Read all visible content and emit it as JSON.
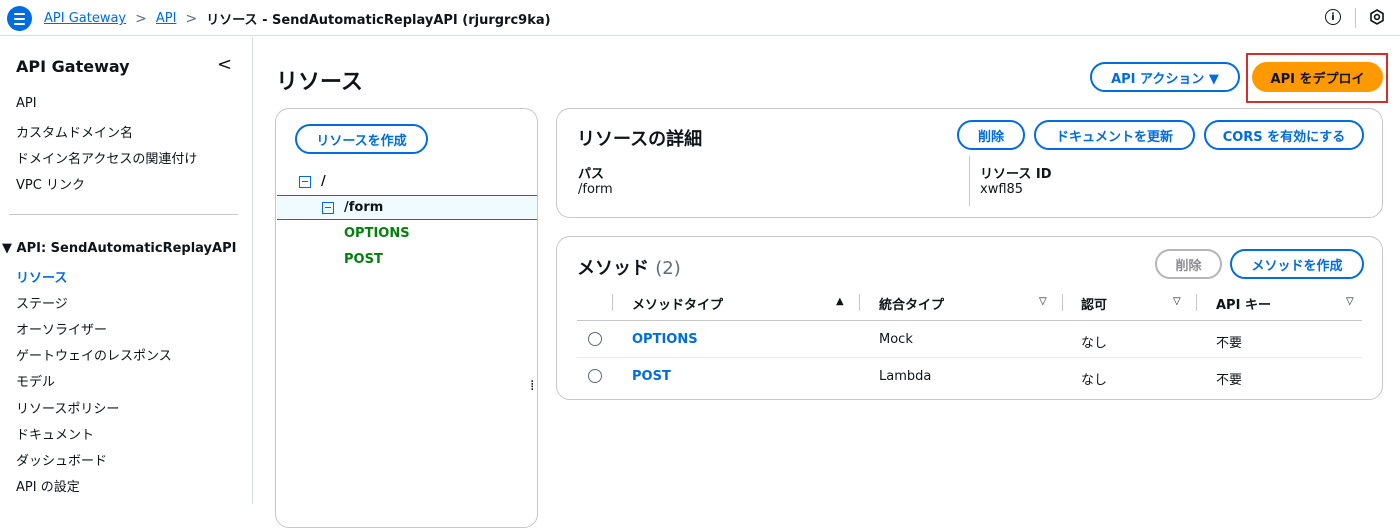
{
  "header": {
    "breadcrumbs": [
      "API Gateway",
      "API",
      "リソース - SendAutomaticReplayAPI (rjurgrc9ka)"
    ],
    "separator": ">",
    "info_label": "i"
  },
  "sidebar": {
    "title": "API Gateway",
    "collapse_label": "<",
    "top_items": [
      "API",
      "カスタムドメイン名",
      "ドメイン名アクセスの関連付け",
      "VPC リンク"
    ],
    "section_label": "▼ API: SendAutomaticReplayAPI",
    "api_items": [
      "リソース",
      "ステージ",
      "オーソライザー",
      "ゲートウェイのレスポンス",
      "モデル",
      "リソースポリシー",
      "ドキュメント",
      "ダッシュボード",
      "API の設定"
    ],
    "active_item": "リソース"
  },
  "main": {
    "title": "リソース",
    "api_actions_label": "API アクション ▼",
    "deploy_label": "API をデプロイ"
  },
  "tree": {
    "create_resource_label": "リソースを作成",
    "root": "/",
    "child": "/form",
    "methods": [
      "OPTIONS",
      "POST"
    ],
    "resize_handle": "⁞"
  },
  "resource_detail": {
    "title": "リソースの詳細",
    "delete_label": "削除",
    "update_docs_label": "ドキュメントを更新",
    "enable_cors_label": "CORS を有効にする",
    "path_label": "パス",
    "path_value": "/form",
    "resource_id_label": "リソース ID",
    "resource_id_value": "xwfl85"
  },
  "methods": {
    "title": "メソッド",
    "count": "(2)",
    "delete_label": "削除",
    "create_label": "メソッドを作成",
    "columns": [
      "メソッドタイプ",
      "統合タイプ",
      "認可",
      "API キー"
    ],
    "sort_icons": [
      "▲",
      "▽",
      "▽",
      "▽"
    ],
    "rows": [
      {
        "method": "OPTIONS",
        "integration": "Mock",
        "auth": "なし",
        "api_key": "不要"
      },
      {
        "method": "POST",
        "integration": "Lambda",
        "auth": "なし",
        "api_key": "不要"
      }
    ]
  },
  "colors": {
    "accent": "#006ce0",
    "deploy": "#ff9900",
    "highlight_border": "#d32f2f",
    "method_green": "#037f0c"
  }
}
